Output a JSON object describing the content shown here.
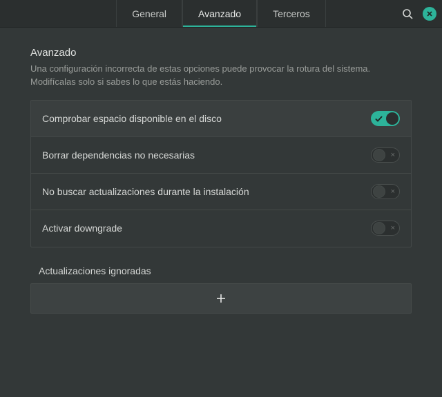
{
  "header": {
    "tabs": [
      {
        "label": "General",
        "active": false
      },
      {
        "label": "Avanzado",
        "active": true
      },
      {
        "label": "Terceros",
        "active": false
      }
    ]
  },
  "section": {
    "title": "Avanzado",
    "description": "Una configuración incorrecta de estas opciones puede provocar la rotura del sistema. Modifícalas solo si sabes lo que estás haciendo."
  },
  "settings": [
    {
      "label": "Comprobar espacio disponible en el disco",
      "on": true,
      "highlight": true
    },
    {
      "label": "Borrar dependencias no necesarias",
      "on": false,
      "highlight": false
    },
    {
      "label": "No buscar actualizaciones durante la instalación",
      "on": false,
      "highlight": false
    },
    {
      "label": "Activar downgrade",
      "on": false,
      "highlight": false
    }
  ],
  "ignored": {
    "title": "Actualizaciones ignoradas"
  }
}
